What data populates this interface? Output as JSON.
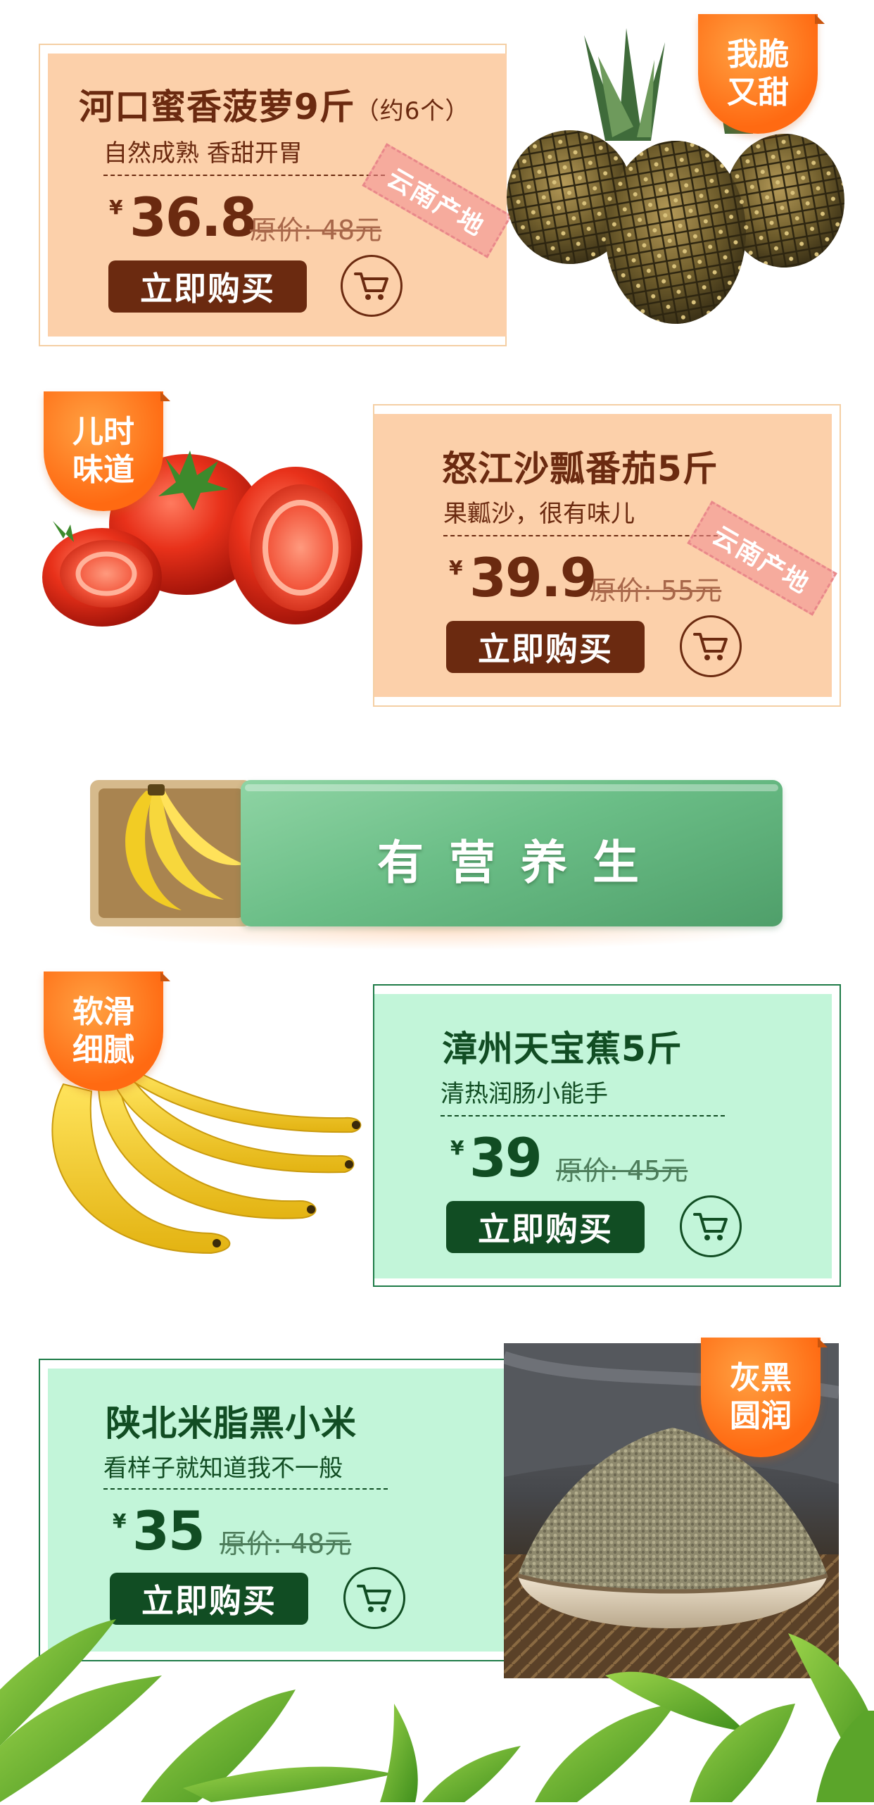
{
  "products": [
    {
      "title": "河口蜜香菠萝9斤",
      "title_note": "（约6个）",
      "subtitle": "自然成熟 香甜开胃",
      "currency": "¥",
      "price": "36.8",
      "original_price": "原价: 48元",
      "stamp": "云南产地",
      "badge": [
        "我脆",
        "又甜"
      ],
      "buy_label": "立即购买",
      "cart_icon": "shopping-cart-icon",
      "image": "pineapples"
    },
    {
      "title": "怒江沙瓢番茄5斤",
      "subtitle": "果瓤沙，很有味儿",
      "currency": "¥",
      "price": "39.9",
      "original_price": "原价: 55元",
      "stamp": "云南产地",
      "badge": [
        "儿时",
        "味道"
      ],
      "buy_label": "立即购买",
      "cart_icon": "shopping-cart-icon",
      "image": "tomatoes"
    },
    {
      "title": "漳州天宝蕉5斤",
      "subtitle": "清热润肠小能手",
      "currency": "¥",
      "price": "39",
      "original_price": "原价: 45元",
      "badge": [
        "软滑",
        "细腻"
      ],
      "buy_label": "立即购买",
      "cart_icon": "shopping-cart-icon",
      "image": "bananas"
    },
    {
      "title": "陕北米脂黑小米",
      "subtitle": "看样子就知道我不一般",
      "currency": "¥",
      "price": "35",
      "original_price": "原价: 48元",
      "badge": [
        "灰黑",
        "圆润"
      ],
      "buy_label": "立即购买",
      "cart_icon": "shopping-cart-icon",
      "image": "millet-bowl"
    }
  ],
  "section_banner": {
    "label": "有营养生",
    "icon": "banana-tray-icon"
  },
  "colors": {
    "peach_card": "#fcd0aa",
    "peach_border": "#f4cfa4",
    "brown": "#6b2a10",
    "green_card": "#c2f5d9",
    "green_border": "#1e7b47",
    "green_dark": "#114d23",
    "badge_orange": "#ff7a1e",
    "banner_green": "#6bbe87"
  }
}
